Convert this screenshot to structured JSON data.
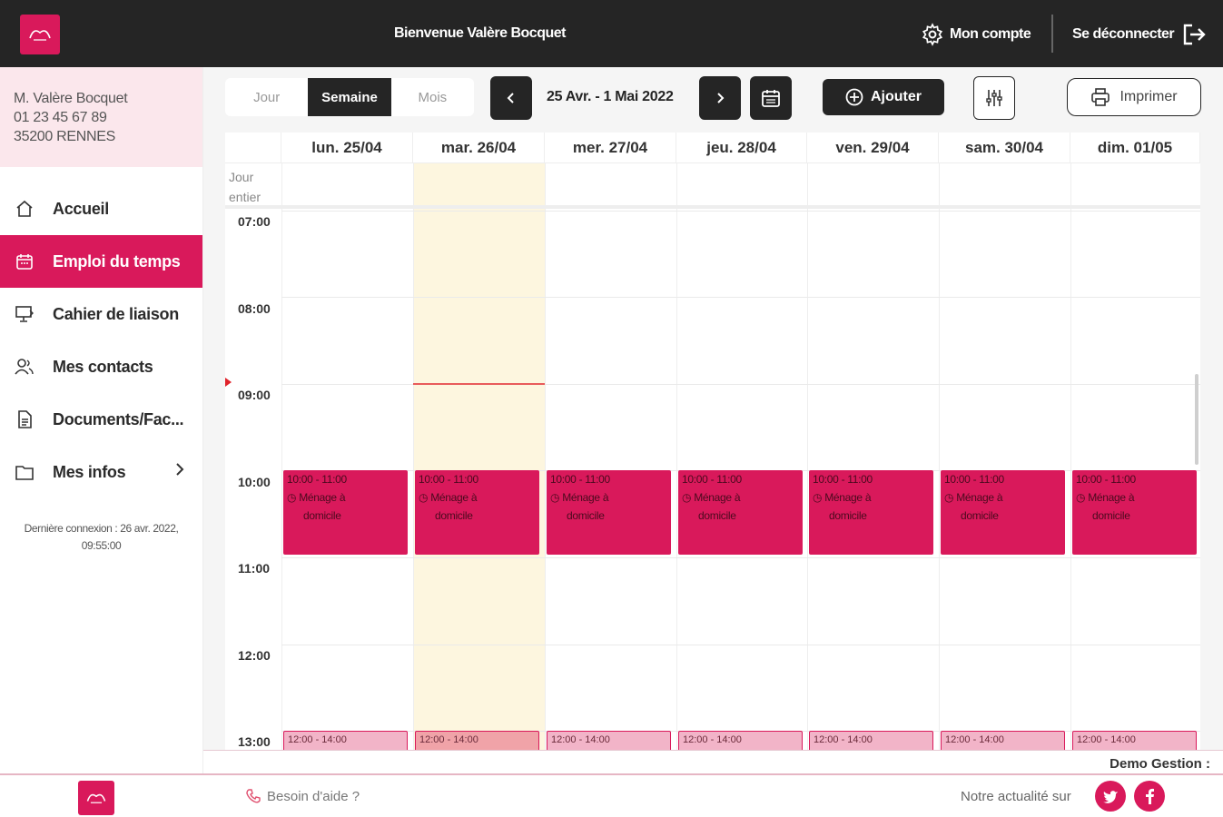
{
  "header": {
    "welcome": "Bienvenue Valère Bocquet",
    "account_label": "Mon compte",
    "logout_label": "Se déconnecter"
  },
  "user": {
    "name": "M. Valère Bocquet",
    "phone": "01 23 45 67 89",
    "city": "35200 RENNES"
  },
  "sidebar": {
    "items": [
      {
        "label": "Accueil",
        "icon": "home-icon"
      },
      {
        "label": "Emploi du temps",
        "icon": "calendar-icon"
      },
      {
        "label": "Cahier de liaison",
        "icon": "monitor-icon"
      },
      {
        "label": "Mes contacts",
        "icon": "contacts-icon"
      },
      {
        "label": "Documents/Fac...",
        "icon": "document-icon"
      },
      {
        "label": "Mes infos",
        "icon": "folder-icon"
      }
    ],
    "last_connection_line1": "Dernière connexion : 26 avr. 2022,",
    "last_connection_line2": "09:55:00"
  },
  "toolbar": {
    "tabs": [
      "Jour",
      "Semaine",
      "Mois"
    ],
    "active_tab": "Semaine",
    "date_range": "25 Avr. - 1 Mai 2022",
    "add_label": "Ajouter",
    "print_label": "Imprimer"
  },
  "calendar": {
    "days": [
      "lun. 25/04",
      "mar. 26/04",
      "mer. 27/04",
      "jeu. 28/04",
      "ven. 29/04",
      "sam. 30/04",
      "dim. 01/05"
    ],
    "allday_label_1": "Jour",
    "allday_label_2": "entier",
    "hours": [
      "07:00",
      "08:00",
      "09:00",
      "10:00",
      "11:00",
      "12:00",
      "13:00"
    ],
    "today_index": 1,
    "event_time": "10:00 - 11:00",
    "event_title_1": "Ménage à",
    "event_title_2": "domicile",
    "event2_time": "12:00 - 14:00"
  },
  "demo_label": "Demo Gestion :",
  "footer": {
    "help_label": "Besoin d'aide ?",
    "news_label": "Notre actualité sur"
  },
  "colors": {
    "brand": "#d9195b",
    "dark": "#252525",
    "today": "#fdf6df"
  }
}
